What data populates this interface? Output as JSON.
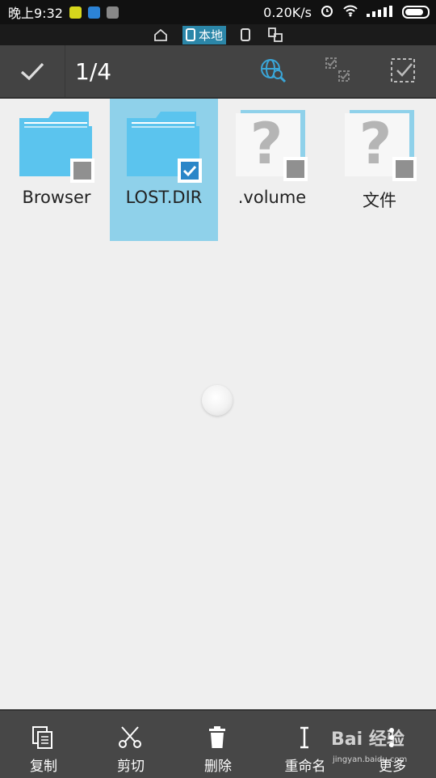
{
  "status_bar": {
    "time": "晚上9:32",
    "network_speed": "0.20K/s",
    "notif_colors": [
      "#d7d71c",
      "#2c83d6",
      "#888888"
    ]
  },
  "location_bar": {
    "active_label": "本地",
    "icons": [
      "home-icon",
      "phone-icon",
      "device-icon",
      "devices-icon"
    ]
  },
  "toolbar": {
    "selection_count": "1/4",
    "icons": [
      "check-icon",
      "network-search-icon",
      "select-range-icon",
      "select-all-icon"
    ]
  },
  "files": [
    {
      "name": "Browser",
      "type": "folder",
      "selected": false
    },
    {
      "name": "LOST.DIR",
      "type": "folder",
      "selected": true
    },
    {
      "name": ".volume",
      "type": "unknown",
      "selected": false
    },
    {
      "name": "文件",
      "type": "unknown",
      "selected": false
    }
  ],
  "bottom_bar": {
    "copy": "复制",
    "cut": "剪切",
    "delete": "删除",
    "rename": "重命名",
    "more": "更多"
  },
  "watermark": {
    "brand": "Bai 经验",
    "site": "jingyan.baidu.com"
  },
  "colors": {
    "accent": "#2b86a8",
    "folder": "#5bc4ee",
    "selection_bg": "#8fd1ea"
  }
}
